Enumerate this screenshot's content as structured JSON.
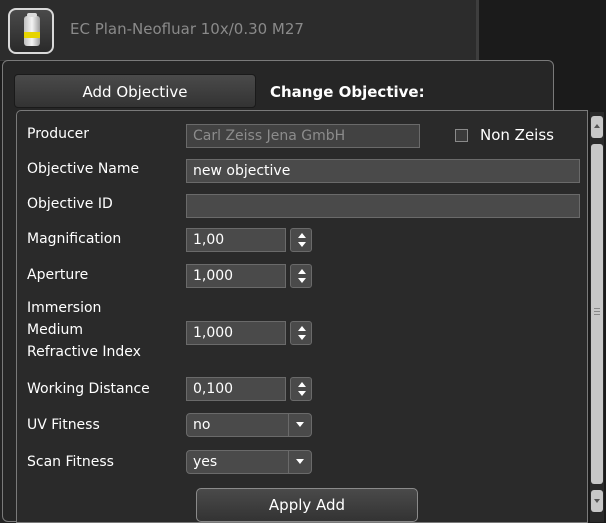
{
  "objective_bar": {
    "title": "EC Plan-Neofluar 10x/0.30 M27",
    "icon": "objective-lens-icon"
  },
  "tabs": {
    "add_label": "Add Objective",
    "change_label": "Change Objective:"
  },
  "form": {
    "producer": {
      "label": "Producer",
      "value": "Carl Zeiss Jena GmbH"
    },
    "non_zeiss": {
      "label": "Non Zeiss",
      "checked": false
    },
    "objective_name": {
      "label": "Objective Name",
      "value": "new objective"
    },
    "objective_id": {
      "label": "Objective ID",
      "value": ""
    },
    "magnification": {
      "label": "Magnification",
      "value": "1,00"
    },
    "aperture": {
      "label": "Aperture",
      "value": "1,000"
    },
    "immersion": {
      "label_line1": "Immersion",
      "label_line2": "Medium",
      "label_line3": "Refractive Index",
      "value": "1,000"
    },
    "working_distance": {
      "label": "Working Distance",
      "value": "0,100"
    },
    "uv_fitness": {
      "label": "UV Fitness",
      "value": "no"
    },
    "scan_fitness": {
      "label": "Scan Fitness",
      "value": "yes"
    },
    "apply_label": "Apply Add"
  },
  "colors": {
    "background": "#1b1b1b",
    "panel": "#2a2a2a",
    "field": "#4a4a4a",
    "accent_band": "#e6d400"
  }
}
